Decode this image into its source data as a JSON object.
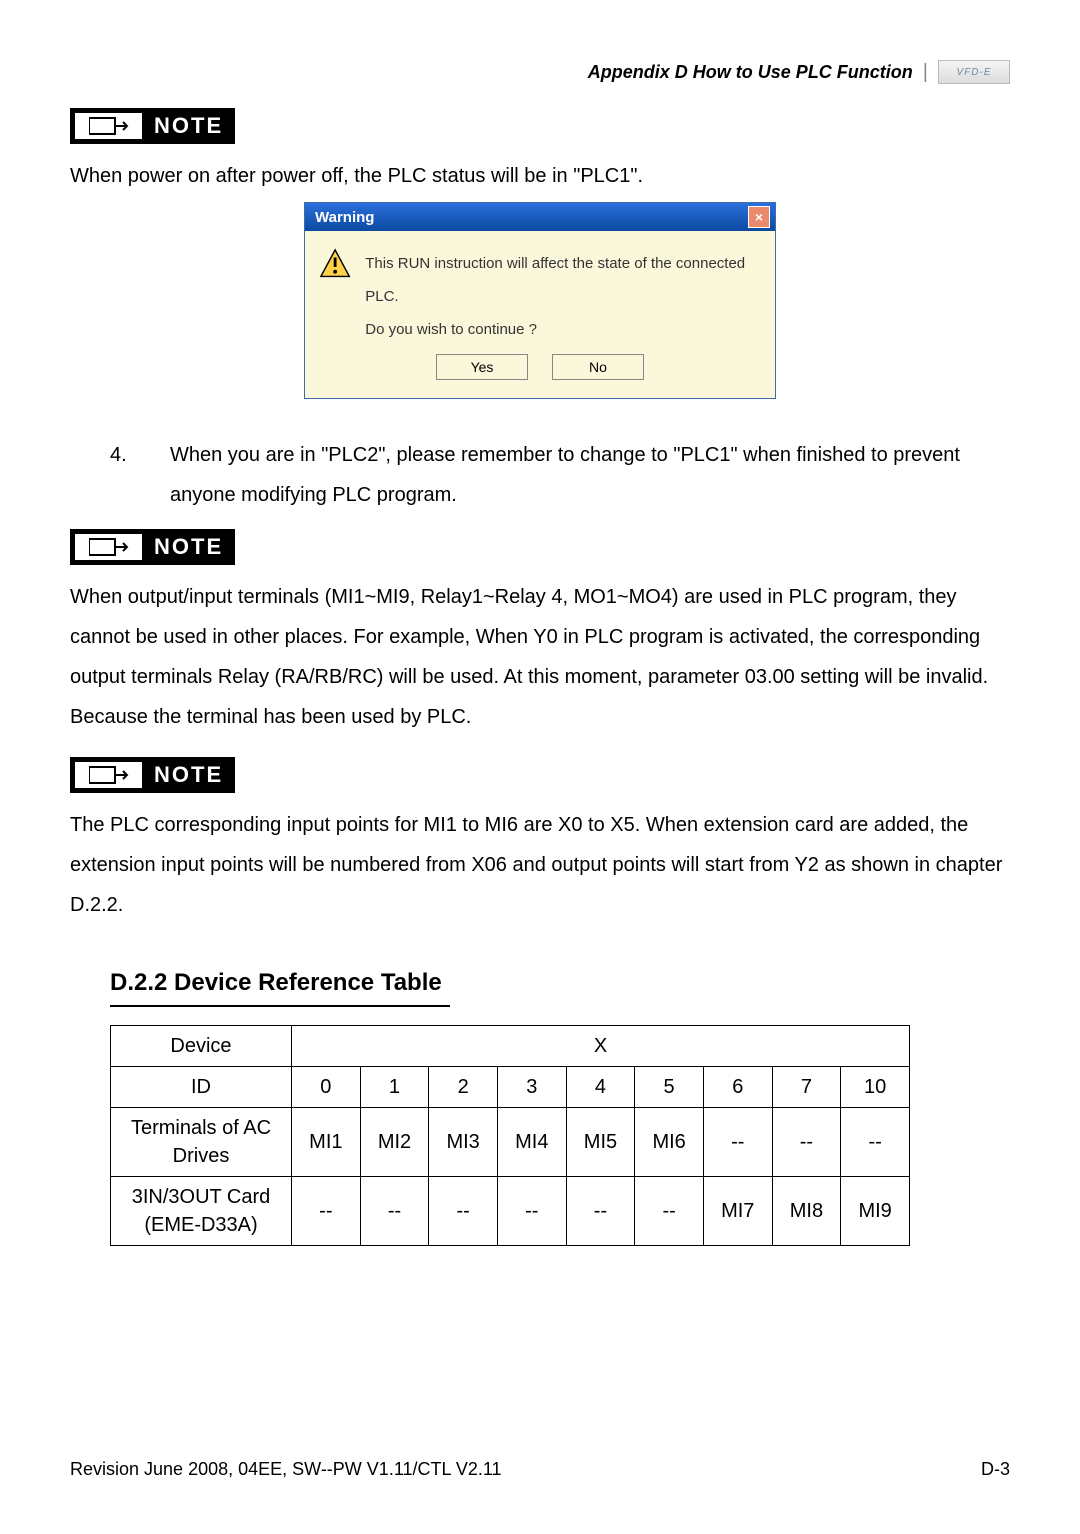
{
  "header": {
    "appendix": "Appendix D How to Use PLC Function",
    "logo_text": "VFD-E"
  },
  "notes": {
    "label": "NOTE",
    "text1": "When power on after power off, the PLC status will be in \"PLC1\".",
    "text2": "When output/input terminals (MI1~MI9, Relay1~Relay 4, MO1~MO4) are used in PLC program, they cannot be used in other places. For example, When Y0 in PLC program is activated, the corresponding output terminals Relay (RA/RB/RC) will be used. At this moment, parameter 03.00 setting will be invalid. Because the terminal has been used by PLC.",
    "text3": "The PLC corresponding input points for MI1 to MI6 are X0 to X5. When extension card are added, the extension input points will be numbered from X06 and output points will start from Y2 as shown in chapter D.2.2."
  },
  "dialog": {
    "title": "Warning",
    "line1": "This RUN instruction will affect the state of the connected PLC.",
    "line2": "Do you wish to continue ?",
    "yes": "Yes",
    "no": "No"
  },
  "list": {
    "num": "4.",
    "text": "When you are in \"PLC2\", please remember to change to \"PLC1\" when finished to prevent anyone modifying PLC program."
  },
  "section": {
    "heading": "D.2.2 Device Reference Table"
  },
  "chart_data": {
    "type": "table",
    "title": "Device Reference Table (X)",
    "device_label": "Device",
    "group_label": "X",
    "columns": [
      "ID",
      "0",
      "1",
      "2",
      "3",
      "4",
      "5",
      "6",
      "7",
      "10"
    ],
    "rows": [
      {
        "label": "Terminals of AC Drives",
        "cells": [
          "MI1",
          "MI2",
          "MI3",
          "MI4",
          "MI5",
          "MI6",
          "--",
          "--",
          "--"
        ]
      },
      {
        "label": "3IN/3OUT Card (EME-D33A)",
        "cells": [
          "--",
          "--",
          "--",
          "--",
          "--",
          "--",
          "MI7",
          "MI8",
          "MI9"
        ]
      }
    ]
  },
  "footer": {
    "left": "Revision June 2008, 04EE, SW--PW V1.11/CTL V2.11",
    "right": "D-3"
  }
}
